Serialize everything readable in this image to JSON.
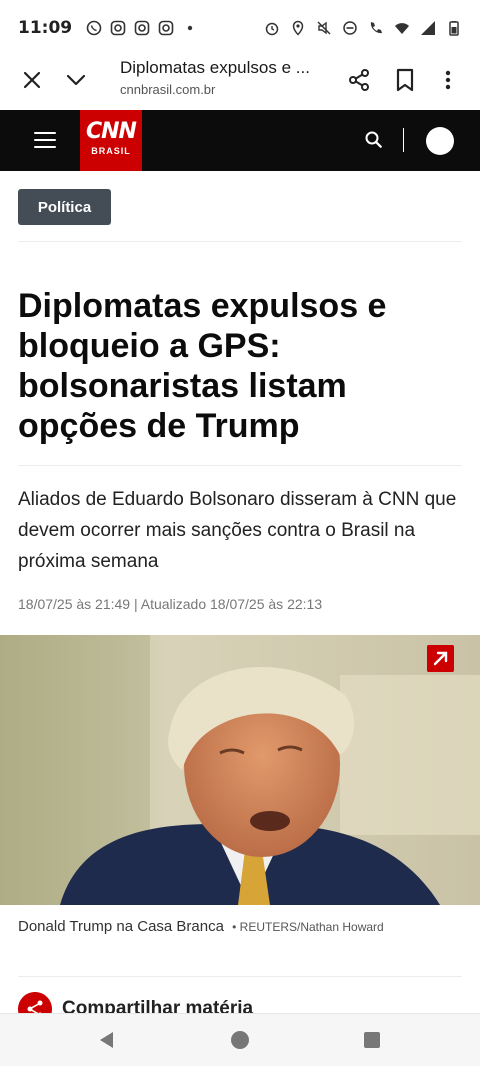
{
  "status_bar": {
    "time": "11:09",
    "left_icons": [
      "whatsapp-icon",
      "instagram-icon",
      "instagram-icon",
      "instagram-icon",
      "dot-icon"
    ],
    "right_icons": [
      "alarm-icon",
      "location-icon",
      "mute-icon",
      "dnd-icon",
      "call-icon",
      "wifi-icon",
      "signal-icon",
      "battery-icon"
    ]
  },
  "browser": {
    "page_title": "Diplomatas expulsos e ...",
    "url": "cnnbrasil.com.br"
  },
  "site_header": {
    "logo_text": "CNN",
    "logo_subtext": "BRASIL"
  },
  "article": {
    "category": "Política",
    "headline": "Diplomatas expulsos e bloqueio a GPS: bolsonaristas listam opções de Trump",
    "lead": "Aliados de Eduardo Bolsonaro disseram à CNN que devem ocorrer mais sanções contra o Brasil na próxima semana",
    "meta": "18/07/25 às 21:49 | Atualizado 18/07/25 às 22:13",
    "image_caption": "Donald Trump na Casa Branca",
    "image_credit": "• REUTERS/Nathan Howard",
    "share_label": "Compartilhar matéria"
  },
  "colors": {
    "cnn_red": "#cc0000",
    "header_black": "#0c0c0c",
    "category_bg": "#444c56"
  }
}
